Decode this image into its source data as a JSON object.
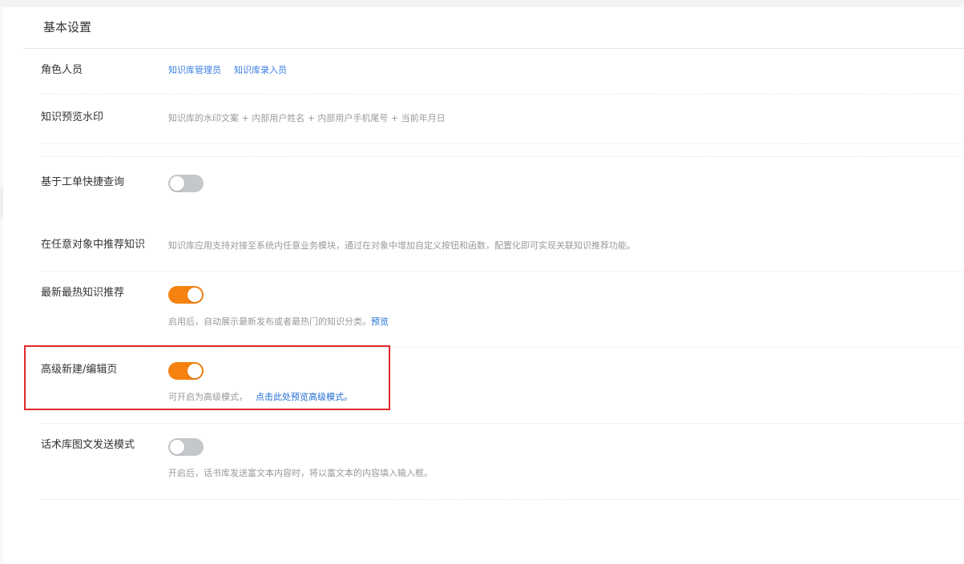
{
  "section": {
    "title": "基本设置"
  },
  "settings": {
    "roles": {
      "label": "角色人员",
      "links": [
        "知识库管理员",
        "知识库录入员"
      ]
    },
    "watermark": {
      "label": "知识预览水印",
      "description": "知识库的水印文案 + 内部用户姓名 + 内部用户手机尾号 + 当前年月日"
    },
    "ticket_query": {
      "label": "基于工单快捷查询",
      "enabled": false
    },
    "recommend_in_object": {
      "label": "在任意对象中推荐知识",
      "description": "知识库应用支持对接至系统内任意业务模块，通过在对象中增加自定义按钮和函数，配置化即可实现关联知识推荐功能。"
    },
    "latest_hot": {
      "label": "最新最热知识推荐",
      "enabled": true,
      "description": "启用后，自动展示最新发布或者最热门的知识分类。",
      "link": "预览"
    },
    "advanced_edit": {
      "label": "高级新建/编辑页",
      "enabled": true,
      "description": "可开启为高级模式，",
      "link": "点击此处预览高级模式。"
    },
    "script_mode": {
      "label": "话术库图文发送模式",
      "enabled": false,
      "description": "开启后，话书库发送富文本内容时，将以富文本的内容填入输入框。"
    }
  },
  "colors": {
    "toggle_on": "#f5820f",
    "toggle_off": "#c4c7cc",
    "link": "#1f6ed4",
    "highlight_border": "#e02a2a"
  }
}
